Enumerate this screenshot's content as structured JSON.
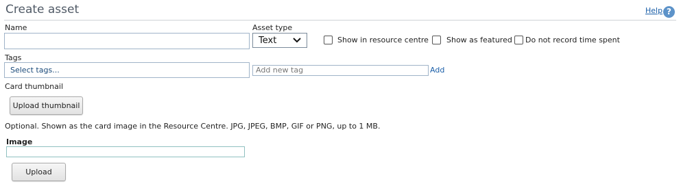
{
  "header": {
    "title": "Create asset",
    "help_label": "Help",
    "help_icon_glyph": "?"
  },
  "form": {
    "name_label": "Name",
    "name_value": "",
    "asset_type_label": "Asset type",
    "asset_type_selected": "Text",
    "show_in_resource_centre_label": "Show in resource centre",
    "show_in_resource_centre_checked": false,
    "show_as_featured_label": "Show as featured",
    "show_as_featured_checked": false,
    "do_not_record_time_label": "Do not record time spent",
    "do_not_record_time_checked": false,
    "tags_label": "Tags",
    "tags_placeholder": "Select tags...",
    "new_tag_placeholder": "Add new tag",
    "add_tag_label": "Add",
    "card_thumbnail_label": "Card thumbnail",
    "upload_thumbnail_label": "Upload thumbnail",
    "thumbnail_help_text": "Optional. Shown as the card image in the Resource Centre. JPG, JPEG, BMP, GIF or PNG, up to 1 MB.",
    "image_label": "Image",
    "image_value": "",
    "upload_label": "Upload"
  },
  "colors": {
    "title": "#505a66",
    "link": "#1a5ea8",
    "help_icon": "#5d93c9"
  }
}
